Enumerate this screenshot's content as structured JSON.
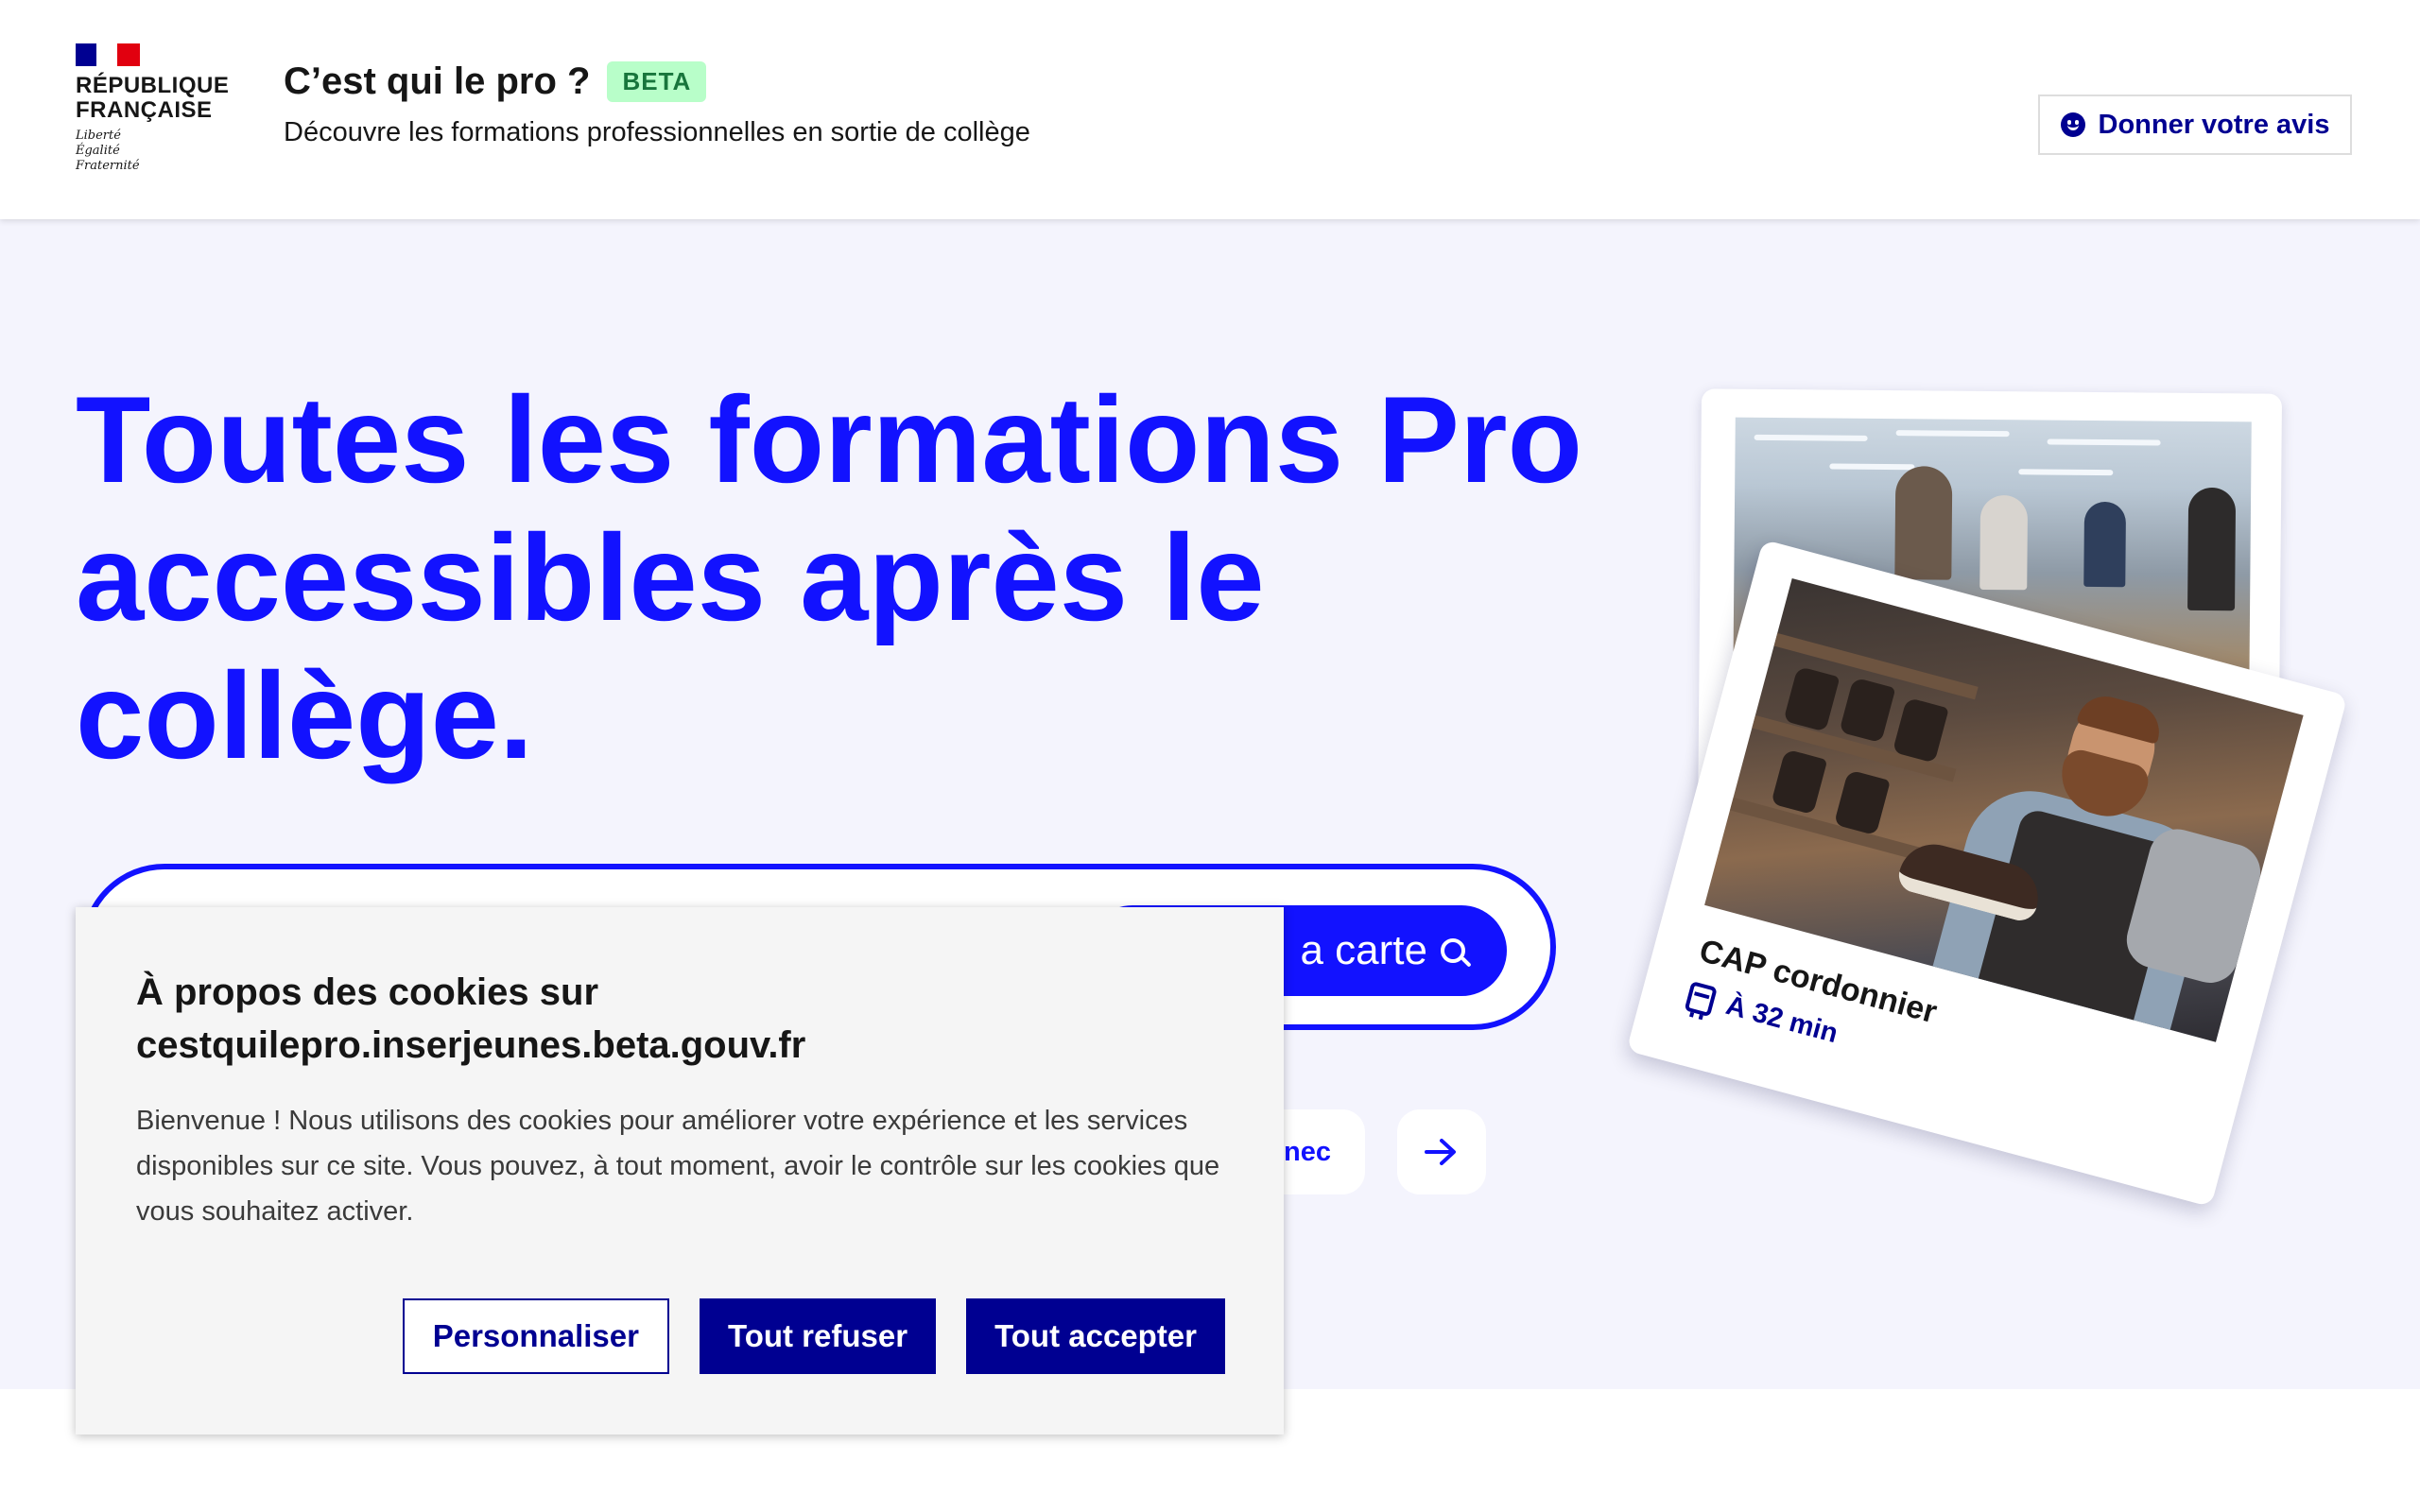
{
  "header": {
    "republic": [
      "RÉPUBLIQUE",
      "FRANÇAISE"
    ],
    "motto": [
      "Liberté",
      "Égalité",
      "Fraternité"
    ],
    "site_title": "C’est qui le pro ?",
    "beta_badge": "BETA",
    "tagline": "Découvre les formations professionnelles en sortie de collège",
    "feedback_button": "Donner votre avis",
    "feedback_icon": "smile-icon"
  },
  "hero": {
    "title": "Toutes les formations Pro accessibles après le collège.",
    "search_button": "a carte",
    "chip_label": "inec",
    "title_color": "#1212ff",
    "card": {
      "caption": "CAP cordonnier",
      "travel_time": "À 32 min",
      "travel_icon": "bus-icon"
    }
  },
  "cookie_banner": {
    "title": "À propos des cookies sur cestquilepro.inserjeunes.beta.gouv.fr",
    "text": "Bienvenue ! Nous utilisons des cookies pour améliorer votre expérience et les services disponibles sur ce site.  Vous pouvez, à tout moment, avoir le contrôle sur les cookies que vous souhaitez activer.",
    "buttons": {
      "customize": "Personnaliser",
      "refuse": "Tout refuser",
      "accept": "Tout accepter"
    }
  },
  "colors": {
    "brand_blue": "#000091",
    "accent_blue": "#1212ff",
    "hero_bg": "#f4f4fd",
    "beta_bg": "#b8fec9",
    "beta_text": "#18753c"
  }
}
